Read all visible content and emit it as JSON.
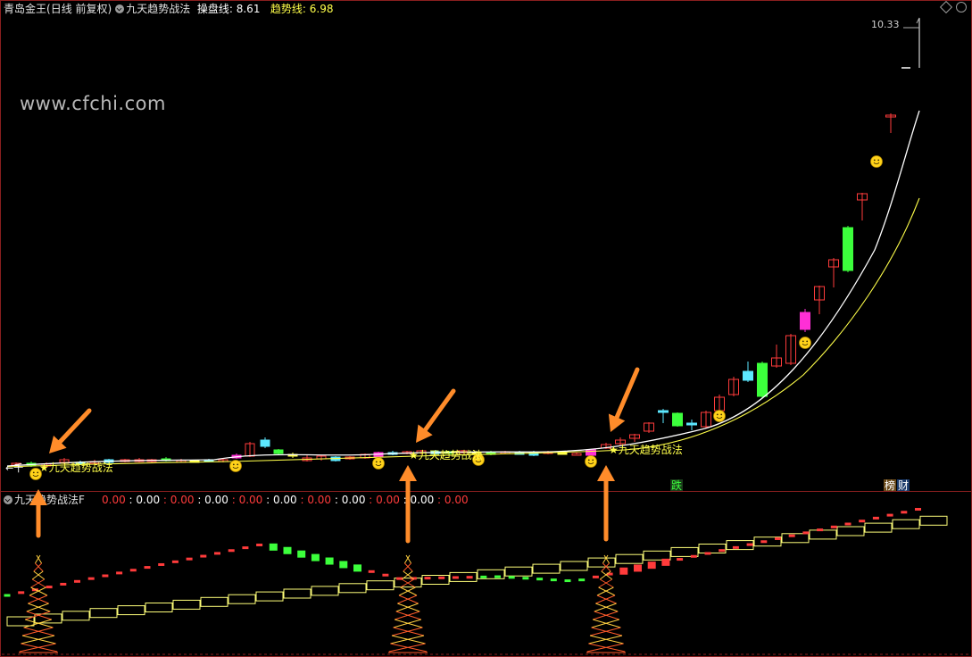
{
  "header": {
    "stock": "青岛金王",
    "period": "(日线 前复权)",
    "indicator": "九天趋势战法",
    "line1_label": "操盘线:",
    "line1_value": "8.61",
    "line2_label": "趋势线:",
    "line2_value": "6.98"
  },
  "watermark": "www.cfchi.com",
  "price_label": "10.33",
  "signal_label": "九天趋势战法",
  "tag_die": "跌",
  "tag_bang": "榜",
  "tag_cai": "财",
  "sub": {
    "title": "九天趋势战法F",
    "values": [
      "0.00",
      "0.00",
      "0.00",
      "0.00",
      "0.00",
      "0.00",
      "0.00",
      "0.00",
      "0.00",
      "0.00",
      "0.00"
    ]
  },
  "colors": {
    "up": "#ff3b3b",
    "down": "#3cff3c",
    "magenta": "#ff2fd6",
    "cyan": "#5ce8ff",
    "yellow": "#ffff4a",
    "arrow": "#ff8c2a",
    "border": "#8a1f1f"
  }
}
